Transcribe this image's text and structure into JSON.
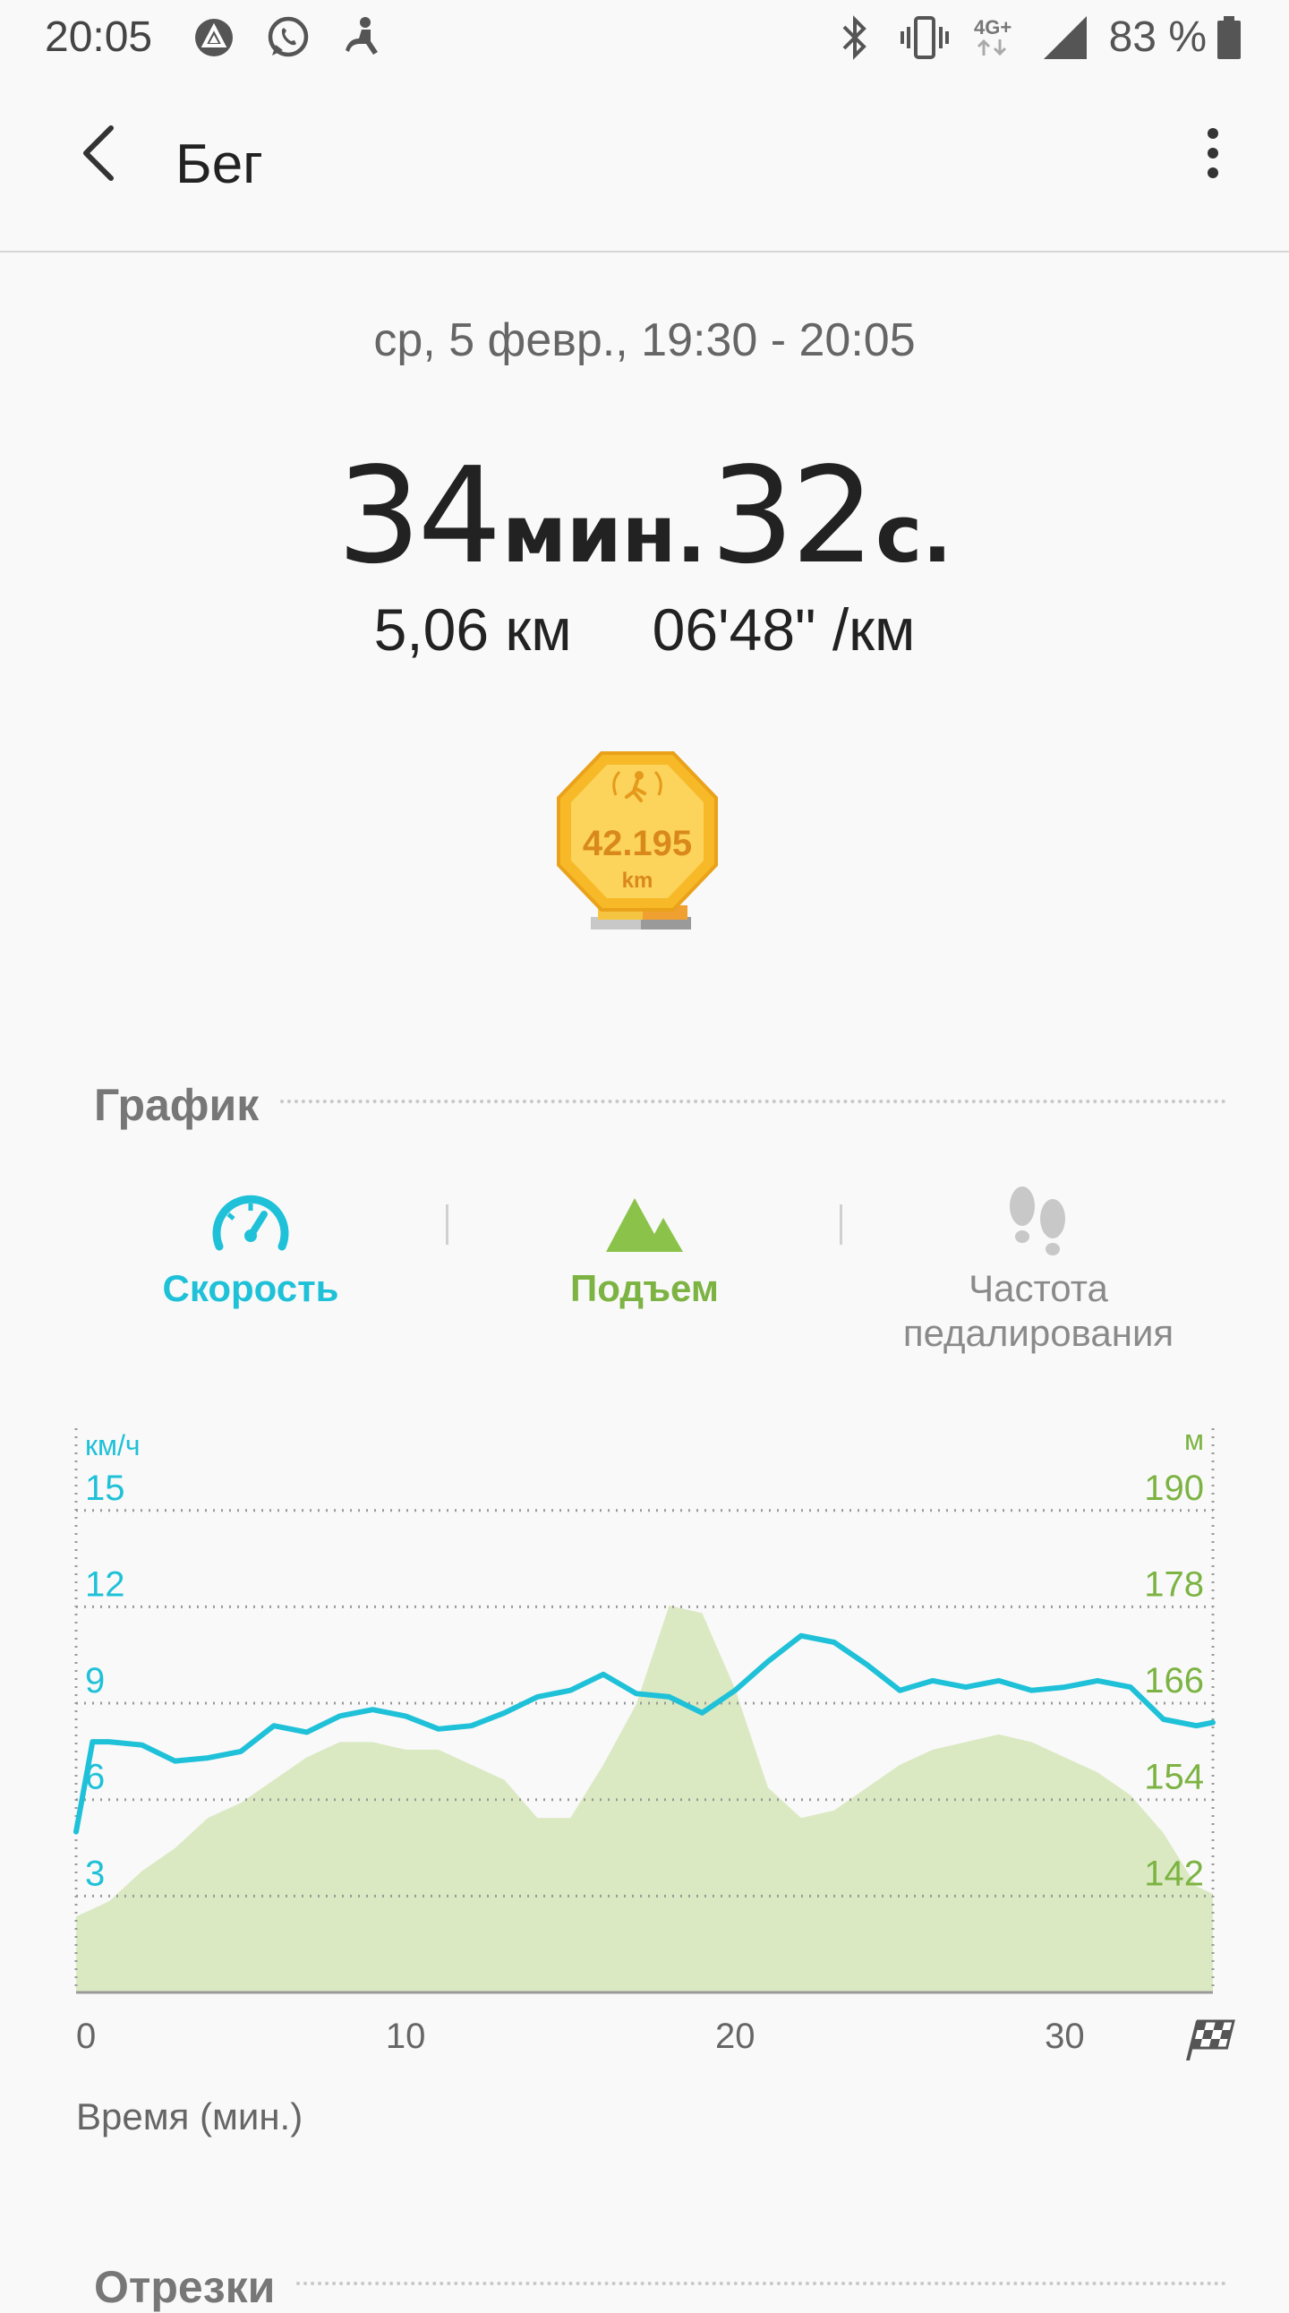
{
  "status_bar": {
    "time": "20:05",
    "battery": "83 %",
    "network": "4G+",
    "icons": [
      "app-notification-icon",
      "whatsapp-icon",
      "accessibility-icon",
      "bluetooth-icon",
      "vibrate-icon",
      "network-4g-icon",
      "signal-icon",
      "battery-icon"
    ]
  },
  "app_bar": {
    "title": "Бег"
  },
  "workout": {
    "date_range": "ср, 5 февр., 19:30 - 20:05",
    "duration_min": "34",
    "duration_min_unit": "мин.",
    "duration_sec": "32",
    "duration_sec_unit": "с.",
    "distance": "5,06 км",
    "pace": "06'48\" /км",
    "badge_value": "42.195",
    "badge_unit": "km"
  },
  "graph_section": {
    "title": "График"
  },
  "tabs": [
    {
      "label": "Скорость",
      "state": "selected",
      "color": "#1fc1d8"
    },
    {
      "label": "Подъем",
      "state": "selected",
      "color": "#7cb342"
    },
    {
      "label": "Частота педалирования",
      "state": "inactive",
      "color": "#8a8a8a"
    }
  ],
  "chart_data": {
    "type": "line",
    "x_unit_label": "Время (мин.)",
    "x_ticks": [
      0,
      10,
      20,
      30
    ],
    "xlim": [
      0,
      34.5
    ],
    "left_axis": {
      "unit": "км/ч",
      "ticks": [
        3,
        6,
        9,
        12,
        15
      ],
      "ylim": [
        0,
        17
      ]
    },
    "right_axis": {
      "unit": "м",
      "ticks": [
        142,
        154,
        166,
        178,
        190
      ],
      "ylim": [
        130,
        202
      ]
    },
    "grid": true,
    "series": [
      {
        "name": "Скорость",
        "type": "line",
        "axis": "left",
        "color": "#1fc1d8",
        "x": [
          0,
          0.5,
          1,
          2,
          3,
          4,
          5,
          6,
          7,
          8,
          9,
          10,
          11,
          12,
          13,
          14,
          15,
          16,
          17,
          18,
          19,
          20,
          21,
          22,
          23,
          24,
          25,
          26,
          27,
          28,
          29,
          30,
          31,
          32,
          33,
          34,
          34.5
        ],
        "values": [
          5.0,
          7.8,
          7.8,
          7.7,
          7.2,
          7.3,
          7.5,
          8.3,
          8.1,
          8.6,
          8.8,
          8.6,
          8.2,
          8.3,
          8.7,
          9.2,
          9.4,
          9.9,
          9.3,
          9.2,
          8.7,
          9.4,
          10.3,
          11.1,
          10.9,
          10.2,
          9.4,
          9.7,
          9.5,
          9.7,
          9.4,
          9.5,
          9.7,
          9.5,
          8.5,
          8.3,
          8.4
        ]
      },
      {
        "name": "Подъем",
        "type": "area",
        "axis": "right",
        "color": "#dbe9c3",
        "x": [
          0,
          1,
          2,
          3,
          4,
          5,
          6,
          7,
          8,
          9,
          10,
          11,
          12,
          13,
          14,
          15,
          16,
          17,
          18,
          19,
          20,
          21,
          22,
          23,
          24,
          25,
          26,
          27,
          28,
          29,
          30,
          31,
          32,
          33,
          34,
          34.5
        ],
        "values": [
          140,
          142,
          146,
          149,
          153,
          155,
          158,
          161,
          163,
          163,
          162,
          162,
          160,
          158,
          153,
          153,
          160,
          168,
          181,
          180,
          170,
          157,
          153,
          154,
          157,
          160,
          162,
          163,
          164,
          163,
          161,
          159,
          156,
          151,
          144,
          143
        ]
      }
    ]
  },
  "segments_section": {
    "title": "Отрезки"
  }
}
